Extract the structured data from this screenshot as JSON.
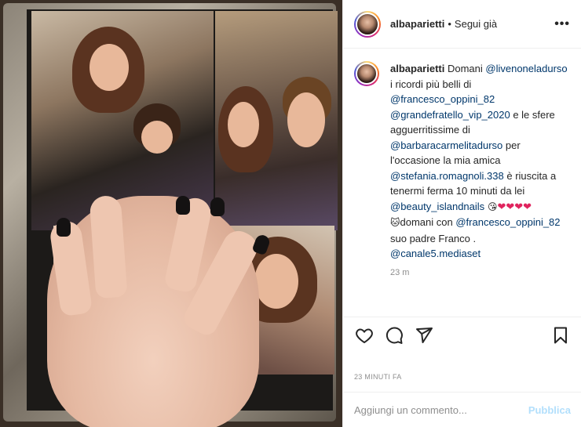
{
  "post": {
    "username": "albaparietti",
    "separator": "•",
    "follow_label": "Segui già",
    "more_icon": "more-icon",
    "colors": {
      "mention": "#00376b",
      "secondary_text": "#8e8e8e",
      "publish_disabled": "#b2dffc",
      "heart": "#e0245e"
    }
  },
  "caption": {
    "username": "albaparietti",
    "t1": " Domani ",
    "m1": "@livenoneladurso",
    "t2": " i ricordi più belli di ",
    "m2": "@francesco_oppini_82",
    "t3": " ",
    "m3": "@grandefratello_vip_2020",
    "t4": " e le sfere agguerritissime di ",
    "m4": "@barbaracarmelitadurso",
    "t5": " per l'occasione la mia amica ",
    "m5": "@stefania.romagnoli.338",
    "t6": " è riuscita a tenermi ferma 10 minuti da lei ",
    "m6": "@beauty_islandnails",
    "e1": " 😘",
    "hearts": "❤❤❤❤",
    "e2": " 🐱",
    "t7": "domani con ",
    "m7": "@francesco_oppini_82",
    "t8": " suo padre Franco . ",
    "m8": "@canale5.mediaset",
    "time": "23 m"
  },
  "actions": {
    "like_icon": "heart-icon",
    "comment_icon": "comment-icon",
    "share_icon": "share-icon",
    "save_icon": "bookmark-icon"
  },
  "posted_time": "23 MINUTI FA",
  "add_comment": {
    "placeholder": "Aggiungi un commento...",
    "publish_label": "Pubblica"
  }
}
